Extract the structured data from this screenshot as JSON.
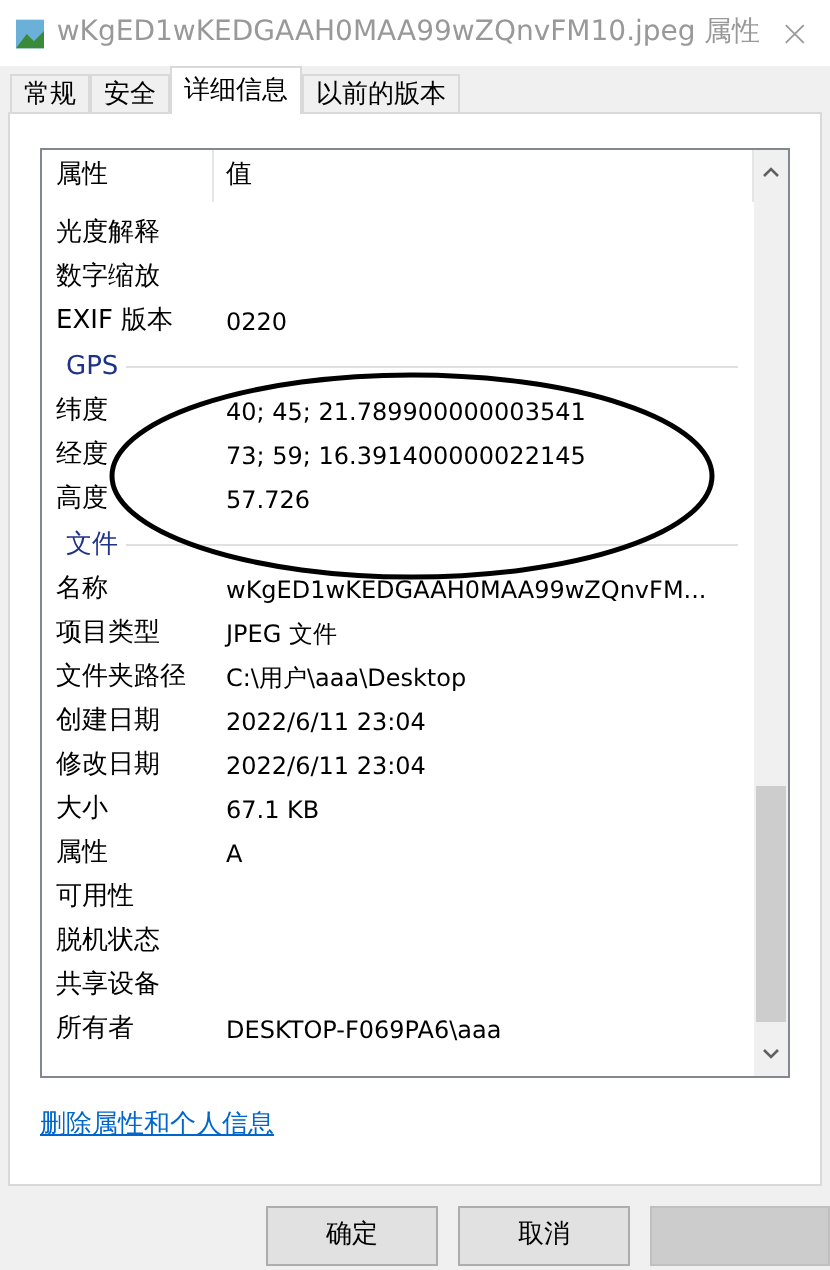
{
  "window": {
    "title": "wKgED1wKEDGAAH0MAA99wZQnvFM10.jpeg 属性"
  },
  "tabs": [
    {
      "label": "常规",
      "selected": false
    },
    {
      "label": "安全",
      "selected": false
    },
    {
      "label": "详细信息",
      "selected": true
    },
    {
      "label": "以前的版本",
      "selected": false
    }
  ],
  "table": {
    "columns": [
      "属性",
      "值"
    ],
    "rows": [
      {
        "kind": "row",
        "name": "光度解释"
      },
      {
        "kind": "row",
        "name": "数字缩放"
      },
      {
        "kind": "row",
        "name": "EXIF 版本",
        "value": "0220"
      },
      {
        "kind": "group",
        "name": "GPS"
      },
      {
        "kind": "row",
        "name": "纬度",
        "value": "40; 45; 21.789900000003541"
      },
      {
        "kind": "row",
        "name": "经度",
        "value": "73; 59; 16.391400000022145"
      },
      {
        "kind": "row",
        "name": "高度",
        "value": "57.726"
      },
      {
        "kind": "group",
        "name": "文件"
      },
      {
        "kind": "row",
        "name": "名称",
        "value": "wKgED1wKEDGAAH0MAA99wZQnvFM..."
      },
      {
        "kind": "row",
        "name": "项目类型",
        "value": "JPEG 文件"
      },
      {
        "kind": "row",
        "name": "文件夹路径",
        "value": "C:\\用户\\aaa\\Desktop"
      },
      {
        "kind": "row",
        "name": "创建日期",
        "value": "2022/6/11 23:04"
      },
      {
        "kind": "row",
        "name": "修改日期",
        "value": "2022/6/11 23:04"
      },
      {
        "kind": "row",
        "name": "大小",
        "value": "67.1 KB"
      },
      {
        "kind": "row",
        "name": "属性",
        "value": "A"
      },
      {
        "kind": "row",
        "name": "可用性"
      },
      {
        "kind": "row",
        "name": "脱机状态"
      },
      {
        "kind": "row",
        "name": "共享设备"
      },
      {
        "kind": "row",
        "name": "所有者",
        "value": "DESKTOP-F069PA6\\aaa"
      }
    ]
  },
  "link": "删除属性和个人信息",
  "buttons": [
    {
      "label": "确定",
      "disabled": false
    },
    {
      "label": "取消",
      "disabled": false
    },
    {
      "disabled": true
    }
  ]
}
